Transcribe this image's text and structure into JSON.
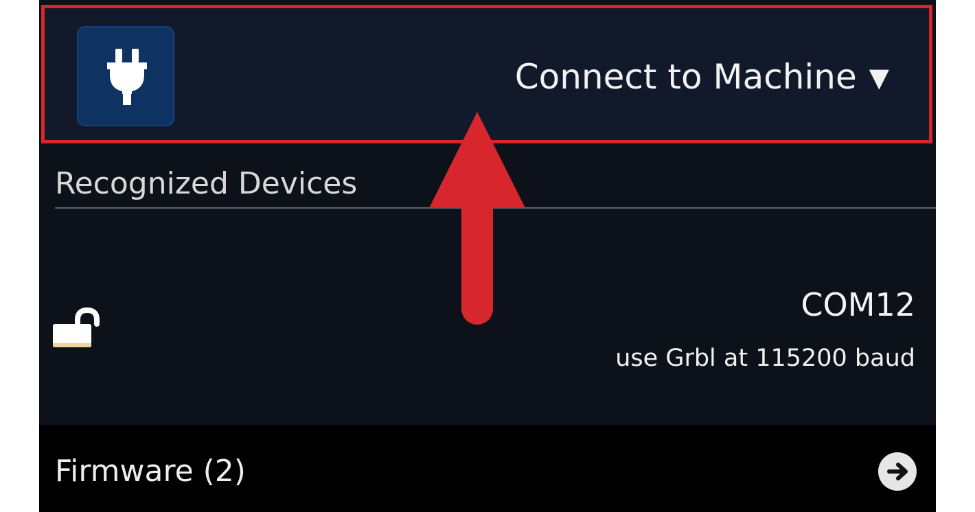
{
  "connection_header": {
    "title": "Connect to Machine",
    "caret": "▼",
    "icon": "plug-icon"
  },
  "recognized_devices": {
    "heading": "Recognized Devices",
    "items": [
      {
        "port": "COM12",
        "description": "use Grbl at 115200 baud",
        "icon": "unlock-icon"
      }
    ]
  },
  "firmware": {
    "label": "Firmware (2)",
    "icon": "arrow-right-circle-icon"
  },
  "annotation": {
    "highlight_color": "#d8262f",
    "icon": "arrow-up-icon"
  }
}
